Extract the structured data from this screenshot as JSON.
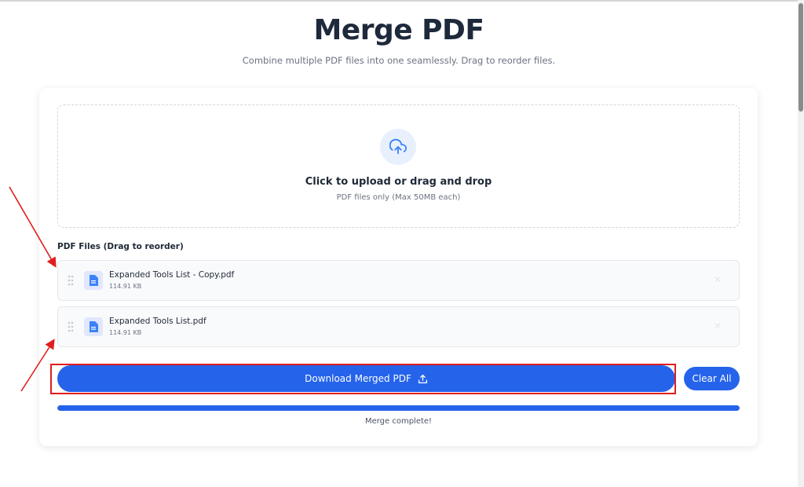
{
  "page": {
    "title": "Merge PDF",
    "subtitle": "Combine multiple PDF files into one seamlessly. Drag to reorder files."
  },
  "dropzone": {
    "title": "Click to upload or drag and drop",
    "subtitle": "PDF files only (Max 50MB each)",
    "icon": "cloud-upload-icon"
  },
  "files": {
    "label": "PDF Files (Drag to reorder)",
    "items": [
      {
        "name": "Expanded Tools List - Copy.pdf",
        "size": "114.91 KB"
      },
      {
        "name": "Expanded Tools List.pdf",
        "size": "114.91 KB"
      }
    ]
  },
  "actions": {
    "download_label": "Download Merged PDF",
    "clear_label": "Clear All"
  },
  "progress": {
    "percent": 100,
    "status": "Merge complete!"
  },
  "colors": {
    "accent": "#2563eb",
    "annotation": "#e11d1d"
  }
}
